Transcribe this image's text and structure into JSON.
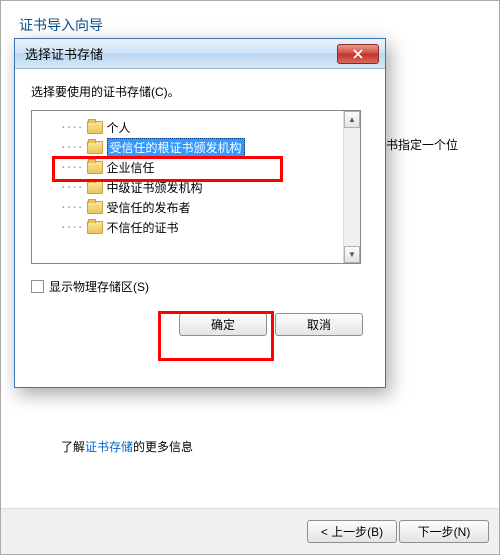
{
  "wizard": {
    "title": "证书导入向导",
    "side_msg": "书指定一个位",
    "info_prefix": "了解",
    "info_link": "证书存储",
    "info_suffix": "的更多信息",
    "prev": "< 上一步(B)",
    "next": "下一步(N)"
  },
  "modal": {
    "title": "选择证书存储",
    "instruction": "选择要使用的证书存储(C)。",
    "tree": [
      {
        "label": "个人",
        "selected": false
      },
      {
        "label": "受信任的根证书颁发机构",
        "selected": true
      },
      {
        "label": "企业信任",
        "selected": false
      },
      {
        "label": "中级证书颁发机构",
        "selected": false
      },
      {
        "label": "受信任的发布者",
        "selected": false
      },
      {
        "label": "不信任的证书",
        "selected": false
      }
    ],
    "checkbox_label": "显示物理存储区(S)",
    "ok": "确定",
    "cancel": "取消"
  }
}
